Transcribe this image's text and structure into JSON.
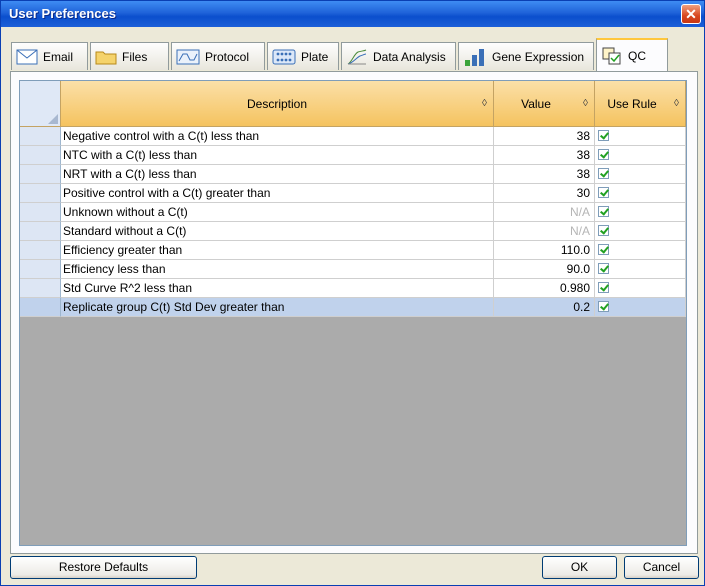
{
  "window": {
    "title": "User Preferences",
    "close_icon": "close-icon"
  },
  "tabs": [
    {
      "label": "Email",
      "icon": "envelope-icon"
    },
    {
      "label": "Files",
      "icon": "folder-icon"
    },
    {
      "label": "Protocol",
      "icon": "protocol-icon"
    },
    {
      "label": "Plate",
      "icon": "plate-icon"
    },
    {
      "label": "Data Analysis",
      "icon": "data-analysis-icon"
    },
    {
      "label": "Gene Expression",
      "icon": "bar-chart-icon"
    },
    {
      "label": "QC",
      "icon": "qc-icon",
      "active": true
    }
  ],
  "grid": {
    "columns": {
      "description": "Description",
      "value": "Value",
      "use_rule": "Use Rule"
    },
    "rows": [
      {
        "description": "Negative control with a C(t) less than",
        "value": "38",
        "use_rule": true
      },
      {
        "description": "NTC with a C(t) less than",
        "value": "38",
        "use_rule": true
      },
      {
        "description": "NRT with a C(t) less than",
        "value": "38",
        "use_rule": true
      },
      {
        "description": "Positive control with a C(t) greater than",
        "value": "30",
        "use_rule": true
      },
      {
        "description": "Unknown without a C(t)",
        "value": "N/A",
        "use_rule": true
      },
      {
        "description": "Standard without a C(t)",
        "value": "N/A",
        "use_rule": true
      },
      {
        "description": "Efficiency greater than",
        "value": "110.0",
        "use_rule": true
      },
      {
        "description": "Efficiency less than",
        "value": "90.0",
        "use_rule": true
      },
      {
        "description": "Std Curve R^2 less than",
        "value": "0.980",
        "use_rule": true
      },
      {
        "description": "Replicate group C(t) Std Dev greater than",
        "value": "0.2",
        "use_rule": true,
        "selected": true
      }
    ]
  },
  "buttons": {
    "restore": "Restore Defaults",
    "ok": "OK",
    "cancel": "Cancel"
  },
  "colors": {
    "title_bar": "#1f63d9",
    "header": "#f5c35f",
    "selection": "#c0d2ec",
    "grid_empty": "#ababab"
  }
}
